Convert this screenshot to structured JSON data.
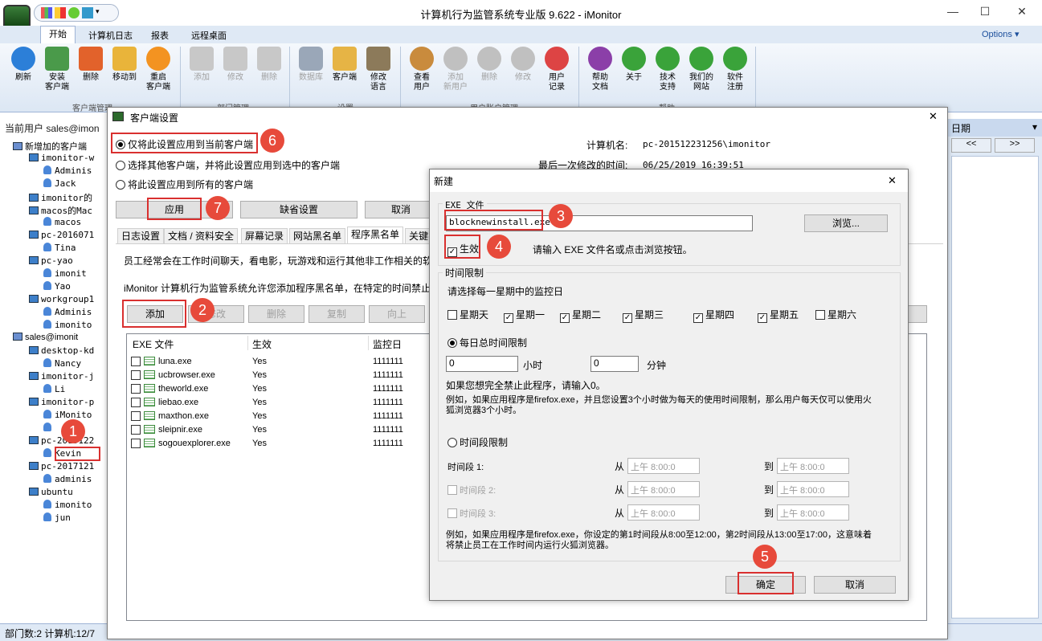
{
  "window": {
    "title": "计算机行为监管系统专业版 9.622 - iMonitor",
    "options": "Options",
    "options_caret": "▾",
    "minimize": "—",
    "maximize": "☐",
    "close": "✕"
  },
  "ribbon_tabs": [
    "开始",
    "计算机日志",
    "报表",
    "远程桌面"
  ],
  "ribbon": {
    "client_buttons": [
      "刷新",
      "安装\n客户端",
      "删除",
      "移动到",
      "重启\n客户端"
    ],
    "client_group": "客户端管理",
    "dept_buttons": [
      "添加",
      "修改",
      "删除"
    ],
    "dept_group": "部门管理",
    "settings_buttons": [
      "数据库",
      "客户端",
      "修改\n语言"
    ],
    "settings_group": "设置",
    "user_buttons": [
      "查看\n用户",
      "添加\n新用户",
      "删除",
      "修改",
      "用户\n记录"
    ],
    "user_group": "用户账户管理",
    "help_buttons": [
      "帮助\n文档",
      "关于",
      "技术\n支持",
      "我们的\n网站",
      "软件\n注册"
    ],
    "help_group": "帮助"
  },
  "left": {
    "header": "当前用户 sales@imon"
  },
  "tree": [
    {
      "t": "新增加的客户端",
      "lvl": 1,
      "k": "grp"
    },
    {
      "t": "imonitor-w",
      "lvl": 2,
      "k": "mon"
    },
    {
      "t": "Adminis",
      "lvl": 3,
      "k": "usr"
    },
    {
      "t": "Jack",
      "lvl": 3,
      "k": "usr"
    },
    {
      "t": "imonitor的",
      "lvl": 2,
      "k": "mon"
    },
    {
      "t": "macos的Mac",
      "lvl": 2,
      "k": "mon"
    },
    {
      "t": "macos",
      "lvl": 3,
      "k": "usr"
    },
    {
      "t": "pc-2016071",
      "lvl": 2,
      "k": "mon"
    },
    {
      "t": "Tina",
      "lvl": 3,
      "k": "usr"
    },
    {
      "t": "pc-yao",
      "lvl": 2,
      "k": "mon"
    },
    {
      "t": "imonit",
      "lvl": 3,
      "k": "usr"
    },
    {
      "t": "Yao",
      "lvl": 3,
      "k": "usr"
    },
    {
      "t": "workgroup1",
      "lvl": 2,
      "k": "mon"
    },
    {
      "t": "Adminis",
      "lvl": 3,
      "k": "usr"
    },
    {
      "t": "imonito",
      "lvl": 3,
      "k": "usr"
    },
    {
      "t": "sales@imonit",
      "lvl": 1,
      "k": "grp"
    },
    {
      "t": "desktop-kd",
      "lvl": 2,
      "k": "mon"
    },
    {
      "t": "Nancy",
      "lvl": 3,
      "k": "usr"
    },
    {
      "t": "imonitor-j",
      "lvl": 2,
      "k": "mon"
    },
    {
      "t": "Li",
      "lvl": 3,
      "k": "usr"
    },
    {
      "t": "imonitor-p",
      "lvl": 2,
      "k": "mon"
    },
    {
      "t": "iMonito",
      "lvl": 3,
      "k": "usr"
    },
    {
      "t": "",
      "lvl": 3,
      "k": "usr"
    },
    {
      "t": "pc-2015122",
      "lvl": 2,
      "k": "mon"
    },
    {
      "t": "Kevin",
      "lvl": 3,
      "k": "usr"
    },
    {
      "t": "pc-2017121",
      "lvl": 2,
      "k": "mon"
    },
    {
      "t": "adminis",
      "lvl": 3,
      "k": "usr"
    },
    {
      "t": "ubuntu",
      "lvl": 2,
      "k": "mon"
    },
    {
      "t": "imonito",
      "lvl": 3,
      "k": "usr"
    },
    {
      "t": "jun",
      "lvl": 3,
      "k": "usr"
    }
  ],
  "status": {
    "text": "部门数:2 计算机:12/7"
  },
  "right_panel": {
    "title": "日期",
    "prev": "<<",
    "next": ">>"
  },
  "client_dialog": {
    "title": "客户端设置",
    "close": "✕",
    "radio_current": "仅将此设置应用到当前客户端",
    "radio_selected": "选择其他客户端，并将此设置应用到选中的客户端",
    "radio_all": "将此设置应用到所有的客户端",
    "computer_label": "计算机名:",
    "computer_value": "pc-201512231256\\imonitor",
    "modified_label": "最后一次修改的时间:",
    "modified_value": "06/25/2019 16:39:51",
    "apply": "应用",
    "default": "缺省设置",
    "cancel": "取消",
    "tabs": [
      "日志设置",
      "文档 / 资料安全",
      "屏幕记录",
      "网站黑名单",
      "程序黑名单",
      "关键字"
    ],
    "desc1": "员工经常会在工作时间聊天，看电影，玩游戏和运行其他非工作相关的软",
    "desc2": "iMonitor 计算机行为监管系统允许您添加程序黑名单，在特定的时间禁止",
    "buttons": [
      "添加",
      "修改",
      "删除",
      "复制",
      "向上"
    ],
    "columns": [
      "EXE 文件",
      "生效",
      "监控日"
    ],
    "rows": [
      {
        "exe": "luna.exe",
        "on": "Yes",
        "days": "1111111"
      },
      {
        "exe": "ucbrowser.exe",
        "on": "Yes",
        "days": "1111111"
      },
      {
        "exe": "theworld.exe",
        "on": "Yes",
        "days": "1111111"
      },
      {
        "exe": "liebao.exe",
        "on": "Yes",
        "days": "1111111"
      },
      {
        "exe": "maxthon.exe",
        "on": "Yes",
        "days": "1111111"
      },
      {
        "exe": "sleipnir.exe",
        "on": "Yes",
        "days": "1111111"
      },
      {
        "exe": "sogouexplorer.exe",
        "on": "Yes",
        "days": "1111111"
      }
    ]
  },
  "new_dialog": {
    "title": "新建",
    "close": "✕",
    "exe_group": "EXE 文件",
    "exe_value": "blocknewinstall.exe",
    "browse": "浏览...",
    "enabled": "生效",
    "hint": "请输入 EXE 文件名或点击浏览按钮。",
    "time_group": "时间限制",
    "choose_days": "请选择每一星期中的监控日",
    "days": [
      {
        "label": "星期天",
        "checked": false
      },
      {
        "label": "星期一",
        "checked": true
      },
      {
        "label": "星期二",
        "checked": true
      },
      {
        "label": "星期三",
        "checked": true
      },
      {
        "label": "星期四",
        "checked": true
      },
      {
        "label": "星期五",
        "checked": true
      },
      {
        "label": "星期六",
        "checked": false
      }
    ],
    "daily_total": "每日总时间限制",
    "hours_value": "0",
    "hours_label": "小时",
    "minutes_value": "0",
    "minutes_label": "分钟",
    "block_hint": "如果您想完全禁止此程序，请输入0。",
    "example1": "例如，如果应用程序是firefox.exe，并且您设置3个小时做为每天的使用时间限制，那么用户每天仅可以使用火狐浏览器3个小时。",
    "period_limit": "时间段限制",
    "period1": "时间段 1:",
    "period2": "时间段 2:",
    "period3": "时间段 3:",
    "from": "从",
    "to": "到",
    "time_value": "上午   8:00:0",
    "example2": "例如，如果应用程序是firefox.exe，你设定的第1时间段从8:00至12:00，第2时间段从13:00至17:00，这意味着将禁止员工在工作时间内运行火狐浏览器。",
    "ok": "确定",
    "cancel": "取消"
  },
  "annotations": [
    "1",
    "2",
    "3",
    "4",
    "5",
    "6",
    "7"
  ]
}
